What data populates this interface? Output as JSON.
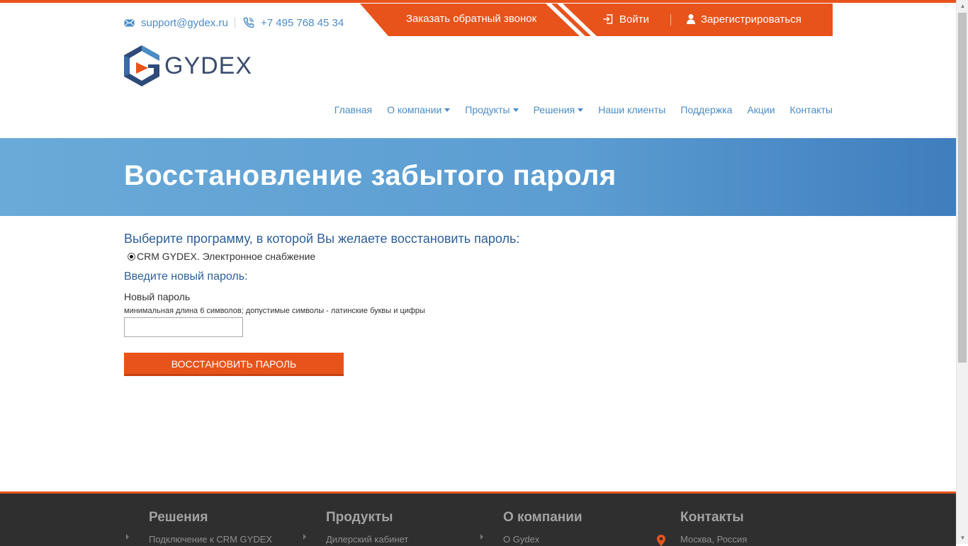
{
  "header": {
    "email": "support@gydex.ru",
    "phone": "+7 495 768 45 34",
    "callback_label": "Заказать обратный звонок",
    "login_label": "Войти",
    "register_label": "Зарегистрироваться",
    "logo_text": "GYDEX"
  },
  "nav": {
    "items": [
      {
        "label": "Главная"
      },
      {
        "label": "О компании"
      },
      {
        "label": "Продукты"
      },
      {
        "label": "Решения"
      },
      {
        "label": "Наши клиенты"
      },
      {
        "label": "Поддержка"
      },
      {
        "label": "Акции"
      },
      {
        "label": "Контакты"
      }
    ]
  },
  "banner": {
    "title": "Восстановление забытого пароля"
  },
  "form": {
    "program_question": "Выберите программу, в которой Вы желаете восстановить пароль:",
    "program_option": "CRM GYDEX. Электронное снабжение",
    "new_password_heading": "Введите новый пароль:",
    "new_password_label": "Новый пароль",
    "new_password_hint": "минимальная длина 6 символов; допустимые символы - латинские буквы и цифры",
    "new_password_value": "",
    "submit_label": "ВОССТАНОВИТЬ ПАРОЛЬ"
  },
  "footer": {
    "columns": [
      {
        "title": "Решения",
        "first_link": "Подключение к CRM GYDEX"
      },
      {
        "title": "Продукты",
        "first_link": "Дилерский кабинет"
      },
      {
        "title": "О компании",
        "first_link": "О Gydex"
      },
      {
        "title": "Контакты",
        "first_link": "Москва, Россия"
      }
    ]
  },
  "colors": {
    "accent": "#e8531c",
    "link": "#4a8cc6",
    "heading_blue": "#2c5e9a",
    "footer_bg": "#2f2f2f"
  },
  "icons": [
    "mail-icon",
    "phone-icon",
    "login-icon",
    "user-icon",
    "location-pin-icon"
  ]
}
